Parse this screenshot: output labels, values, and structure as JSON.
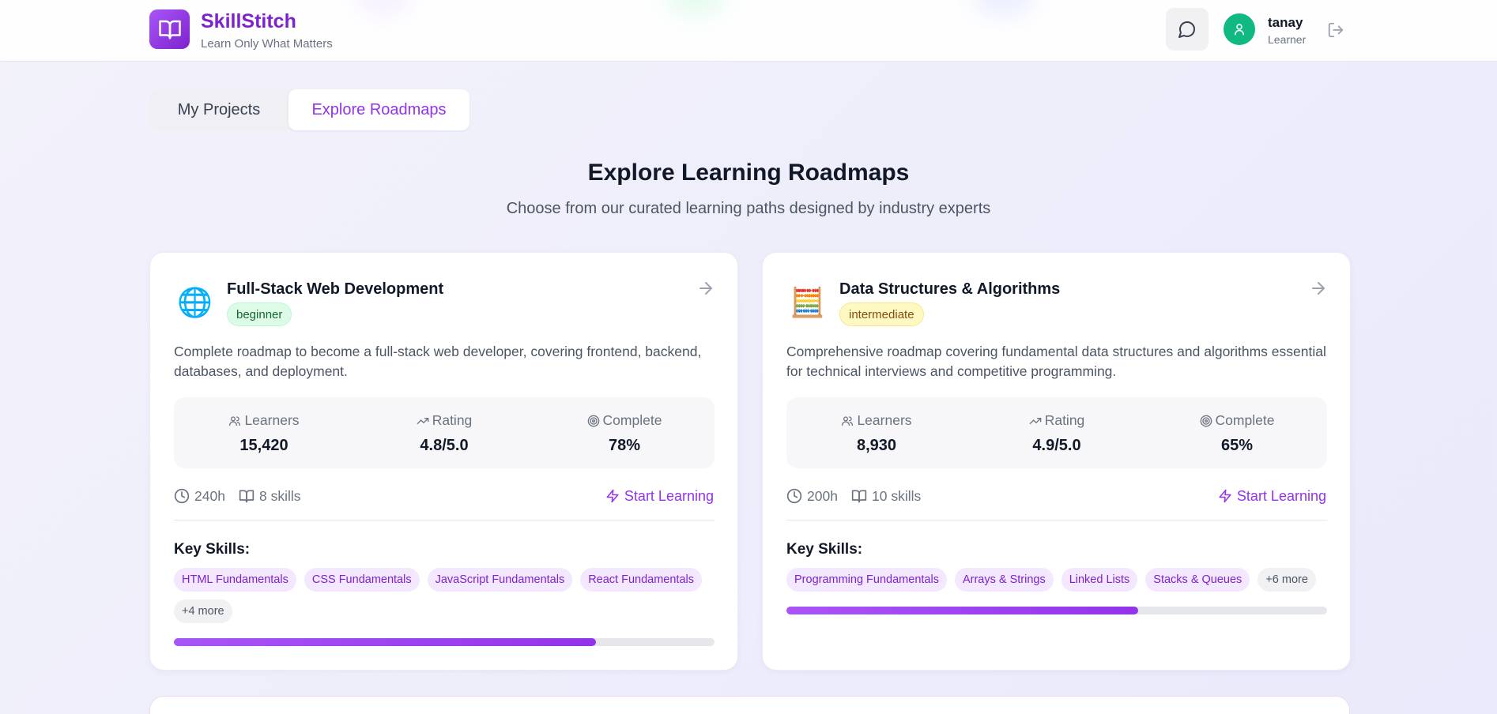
{
  "header": {
    "brand_name": "SkillStitch",
    "brand_tagline": "Learn Only What Matters",
    "user_name": "tanay",
    "user_role": "Learner",
    "icons": {
      "logo": "book-open-icon",
      "chat": "message-circle-icon",
      "avatar": "user-icon",
      "logout": "log-out-icon"
    }
  },
  "tabs": [
    {
      "label": "My Projects",
      "active": false
    },
    {
      "label": "Explore Roadmaps",
      "active": true
    }
  ],
  "page": {
    "title": "Explore Learning Roadmaps",
    "subtitle": "Choose from our curated learning paths designed by industry experts"
  },
  "stat_labels": {
    "learners": "Learners",
    "rating": "Rating",
    "complete": "Complete"
  },
  "key_skills_label": "Key Skills:",
  "start_label": "Start Learning",
  "cards": [
    {
      "emoji": "🌐",
      "title": "Full-Stack Web Development",
      "level": "beginner",
      "level_colors": {
        "bg": "#dcfce7",
        "text": "#166534",
        "border": "#bbf7d0"
      },
      "description": "Complete roadmap to become a full-stack web developer, covering frontend, backend, databases, and deployment.",
      "learners": "15,420",
      "rating": "4.8/5.0",
      "complete": "78%",
      "hours": "240h",
      "skills_count": "8 skills",
      "skills": [
        "HTML Fundamentals",
        "CSS Fundamentals",
        "JavaScript Fundamentals",
        "React Fundamentals"
      ],
      "more": "+4 more",
      "progress": 0.78
    },
    {
      "emoji": "🧮",
      "title": "Data Structures & Algorithms",
      "level": "intermediate",
      "level_colors": {
        "bg": "#fef9c3",
        "text": "#854d0e",
        "border": "#fde68a"
      },
      "description": "Comprehensive roadmap covering fundamental data structures and algorithms essential for technical interviews and competitive programming.",
      "learners": "8,930",
      "rating": "4.9/5.0",
      "complete": "65%",
      "hours": "200h",
      "skills_count": "10 skills",
      "skills": [
        "Programming Fundamentals",
        "Arrays & Strings",
        "Linked Lists",
        "Stacks & Queues"
      ],
      "more": "+6 more",
      "progress": 0.65
    }
  ],
  "colors": {
    "accent": "#9333ea",
    "brand": "#7e22ce",
    "avatar": "#10b981"
  }
}
